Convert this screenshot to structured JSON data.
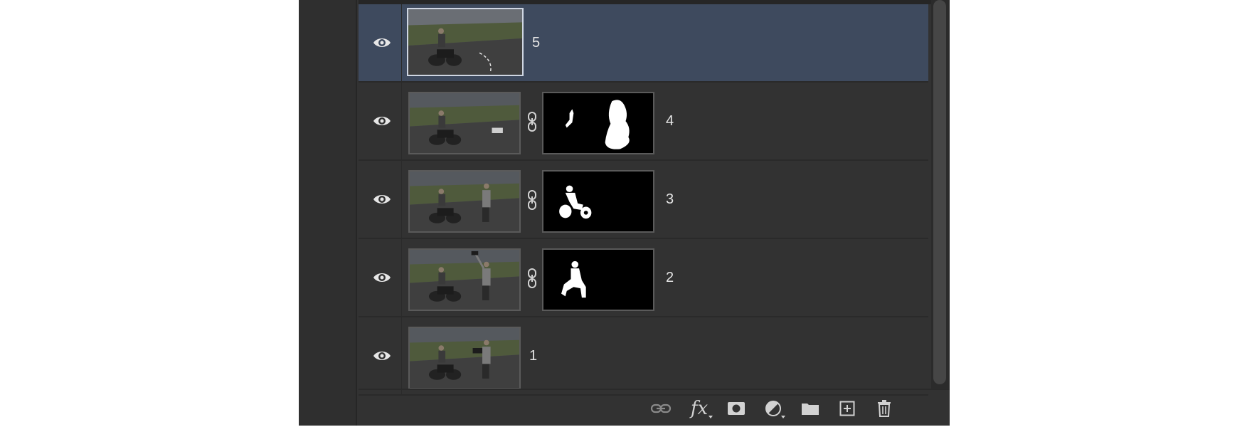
{
  "colors": {
    "panel_bg": "#323232",
    "selected_row": "#3e4a5e",
    "text": "#e6e6e6",
    "icon": "#d2d2d2"
  },
  "layers": [
    {
      "name": "5",
      "selected": true,
      "visible": true,
      "has_mask": false
    },
    {
      "name": "4",
      "selected": false,
      "visible": true,
      "has_mask": true
    },
    {
      "name": "3",
      "selected": false,
      "visible": true,
      "has_mask": true
    },
    {
      "name": "2",
      "selected": false,
      "visible": true,
      "has_mask": true
    },
    {
      "name": "1",
      "selected": false,
      "visible": true,
      "has_mask": false
    }
  ],
  "footer": {
    "icons": [
      "link-layers-icon",
      "fx-icon",
      "add-mask-icon",
      "adjustment-layer-icon",
      "new-group-icon",
      "new-layer-icon",
      "delete-layer-icon"
    ],
    "fx_label": "fx"
  }
}
